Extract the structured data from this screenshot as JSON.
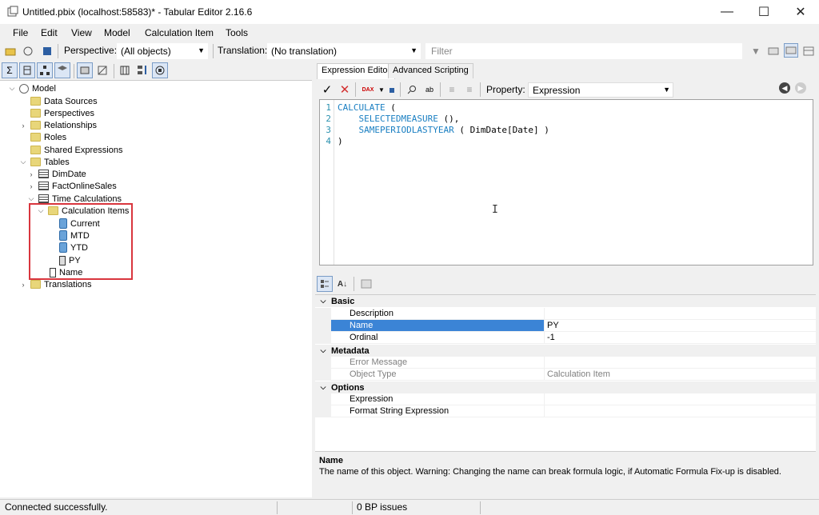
{
  "window": {
    "title": "Untitled.pbix (localhost:58583)* - Tabular Editor 2.16.6",
    "minimize": "—",
    "maximize": "☐",
    "close": "✕"
  },
  "menu": [
    "File",
    "Edit",
    "View",
    "Model",
    "Calculation Item",
    "Tools"
  ],
  "toolbar": {
    "perspective_label": "Perspective:",
    "perspective_value": "(All objects)",
    "translation_label": "Translation:",
    "translation_value": "(No translation)",
    "filter_placeholder": "Filter"
  },
  "tree": {
    "model": "Model",
    "data_sources": "Data Sources",
    "perspectives": "Perspectives",
    "relationships": "Relationships",
    "roles": "Roles",
    "shared_expressions": "Shared Expressions",
    "tables": "Tables",
    "dimdate": "DimDate",
    "factonlinesales": "FactOnlineSales",
    "time_calculations": "Time Calculations",
    "calculation_items": "Calculation Items",
    "current": "Current",
    "mtd": "MTD",
    "ytd": "YTD",
    "py": "PY",
    "name": "Name",
    "translations": "Translations"
  },
  "tabs": {
    "expression_editor": "Expression Editor",
    "advanced_scripting": "Advanced Scripting"
  },
  "expr_toolbar": {
    "property_label": "Property:",
    "property_value": "Expression",
    "dax_label": "DAX"
  },
  "code": {
    "lines": [
      {
        "num": "1",
        "kw": "CALCULATE",
        "rest": " ("
      },
      {
        "num": "2",
        "kw": "SELECTEDMEASURE",
        "rest": " (),",
        "indent": "    "
      },
      {
        "num": "3",
        "kw": "SAMEPERIODLASTYEAR",
        "rest": " ( DimDate[Date] )",
        "indent": "    "
      },
      {
        "num": "4",
        "kw": "",
        "rest": ")"
      }
    ]
  },
  "properties": {
    "basic": "Basic",
    "description_k": "Description",
    "description_v": "",
    "name_k": "Name",
    "name_v": "PY",
    "ordinal_k": "Ordinal",
    "ordinal_v": "-1",
    "metadata": "Metadata",
    "error_k": "Error Message",
    "error_v": "",
    "objtype_k": "Object Type",
    "objtype_v": "Calculation Item",
    "options": "Options",
    "expression_k": "Expression",
    "expression_v": "",
    "fse_k": "Format String Expression",
    "fse_v": ""
  },
  "description_pane": {
    "title": "Name",
    "text": "The name of this object. Warning: Changing the name can break formula logic, if Automatic Formula Fix-up is disabled."
  },
  "status": {
    "connection": "Connected successfully.",
    "bp_issues": "0 BP issues"
  },
  "colors": {
    "selection": "#3b84d6",
    "highlight_box": "#d9363e",
    "keyword": "#1a7fc2"
  }
}
